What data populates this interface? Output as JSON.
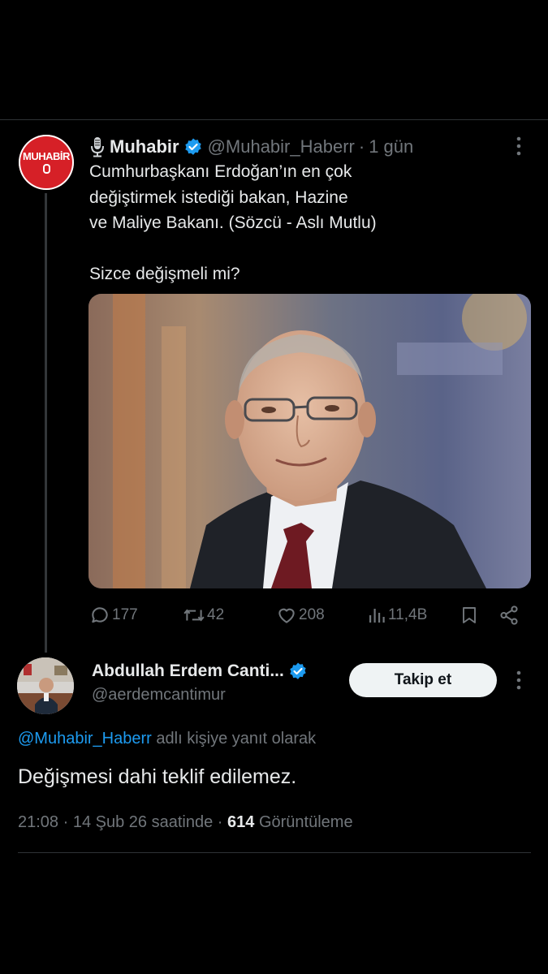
{
  "colors": {
    "background": "#000000",
    "text": "#e7e9ea",
    "secondary_text": "#71767b",
    "link": "#1d9bf0",
    "verified_badge": "#1d9bf0",
    "muhabir_brand": "#d62027",
    "follow_button_bg": "#eff3f4"
  },
  "parent_tweet": {
    "avatar_logo_text": "MUHABİR",
    "author_name": "Muhabir",
    "handle": "@Muhabir_Haberr",
    "separator": "·",
    "time": "1 gün",
    "text_lines": [
      "Cumhurbaşkanı Erdoğan’ın en çok",
      "değiştirmek istediği bakan, Hazine",
      "ve Maliye Bakanı. (Sözcü - Aslı Mutlu)"
    ],
    "question": "Sizce değişmeli mi?",
    "actions": {
      "replies": "177",
      "reposts": "42",
      "likes": "208",
      "views": "11,4B"
    },
    "icons": [
      "mic-icon",
      "verified-badge-icon",
      "more-icon",
      "reply-icon",
      "repost-icon",
      "like-icon",
      "views-icon",
      "bookmark-icon",
      "share-icon"
    ]
  },
  "reply_tweet": {
    "author_name": "Abdullah Erdem Canti...",
    "handle": "@aerdemcantimur",
    "follow_label": "Takip et",
    "reply_to_mention": "@Muhabir_Haberr",
    "reply_to_suffix": " adlı kişiye yanıt olarak",
    "text": "Değişmesi dahi teklif edilemez.",
    "meta": {
      "time": "21:08",
      "date": "14 Şub 26 saatinde",
      "separator": "·",
      "views_count": "614",
      "views_label": "Görüntüleme"
    }
  }
}
